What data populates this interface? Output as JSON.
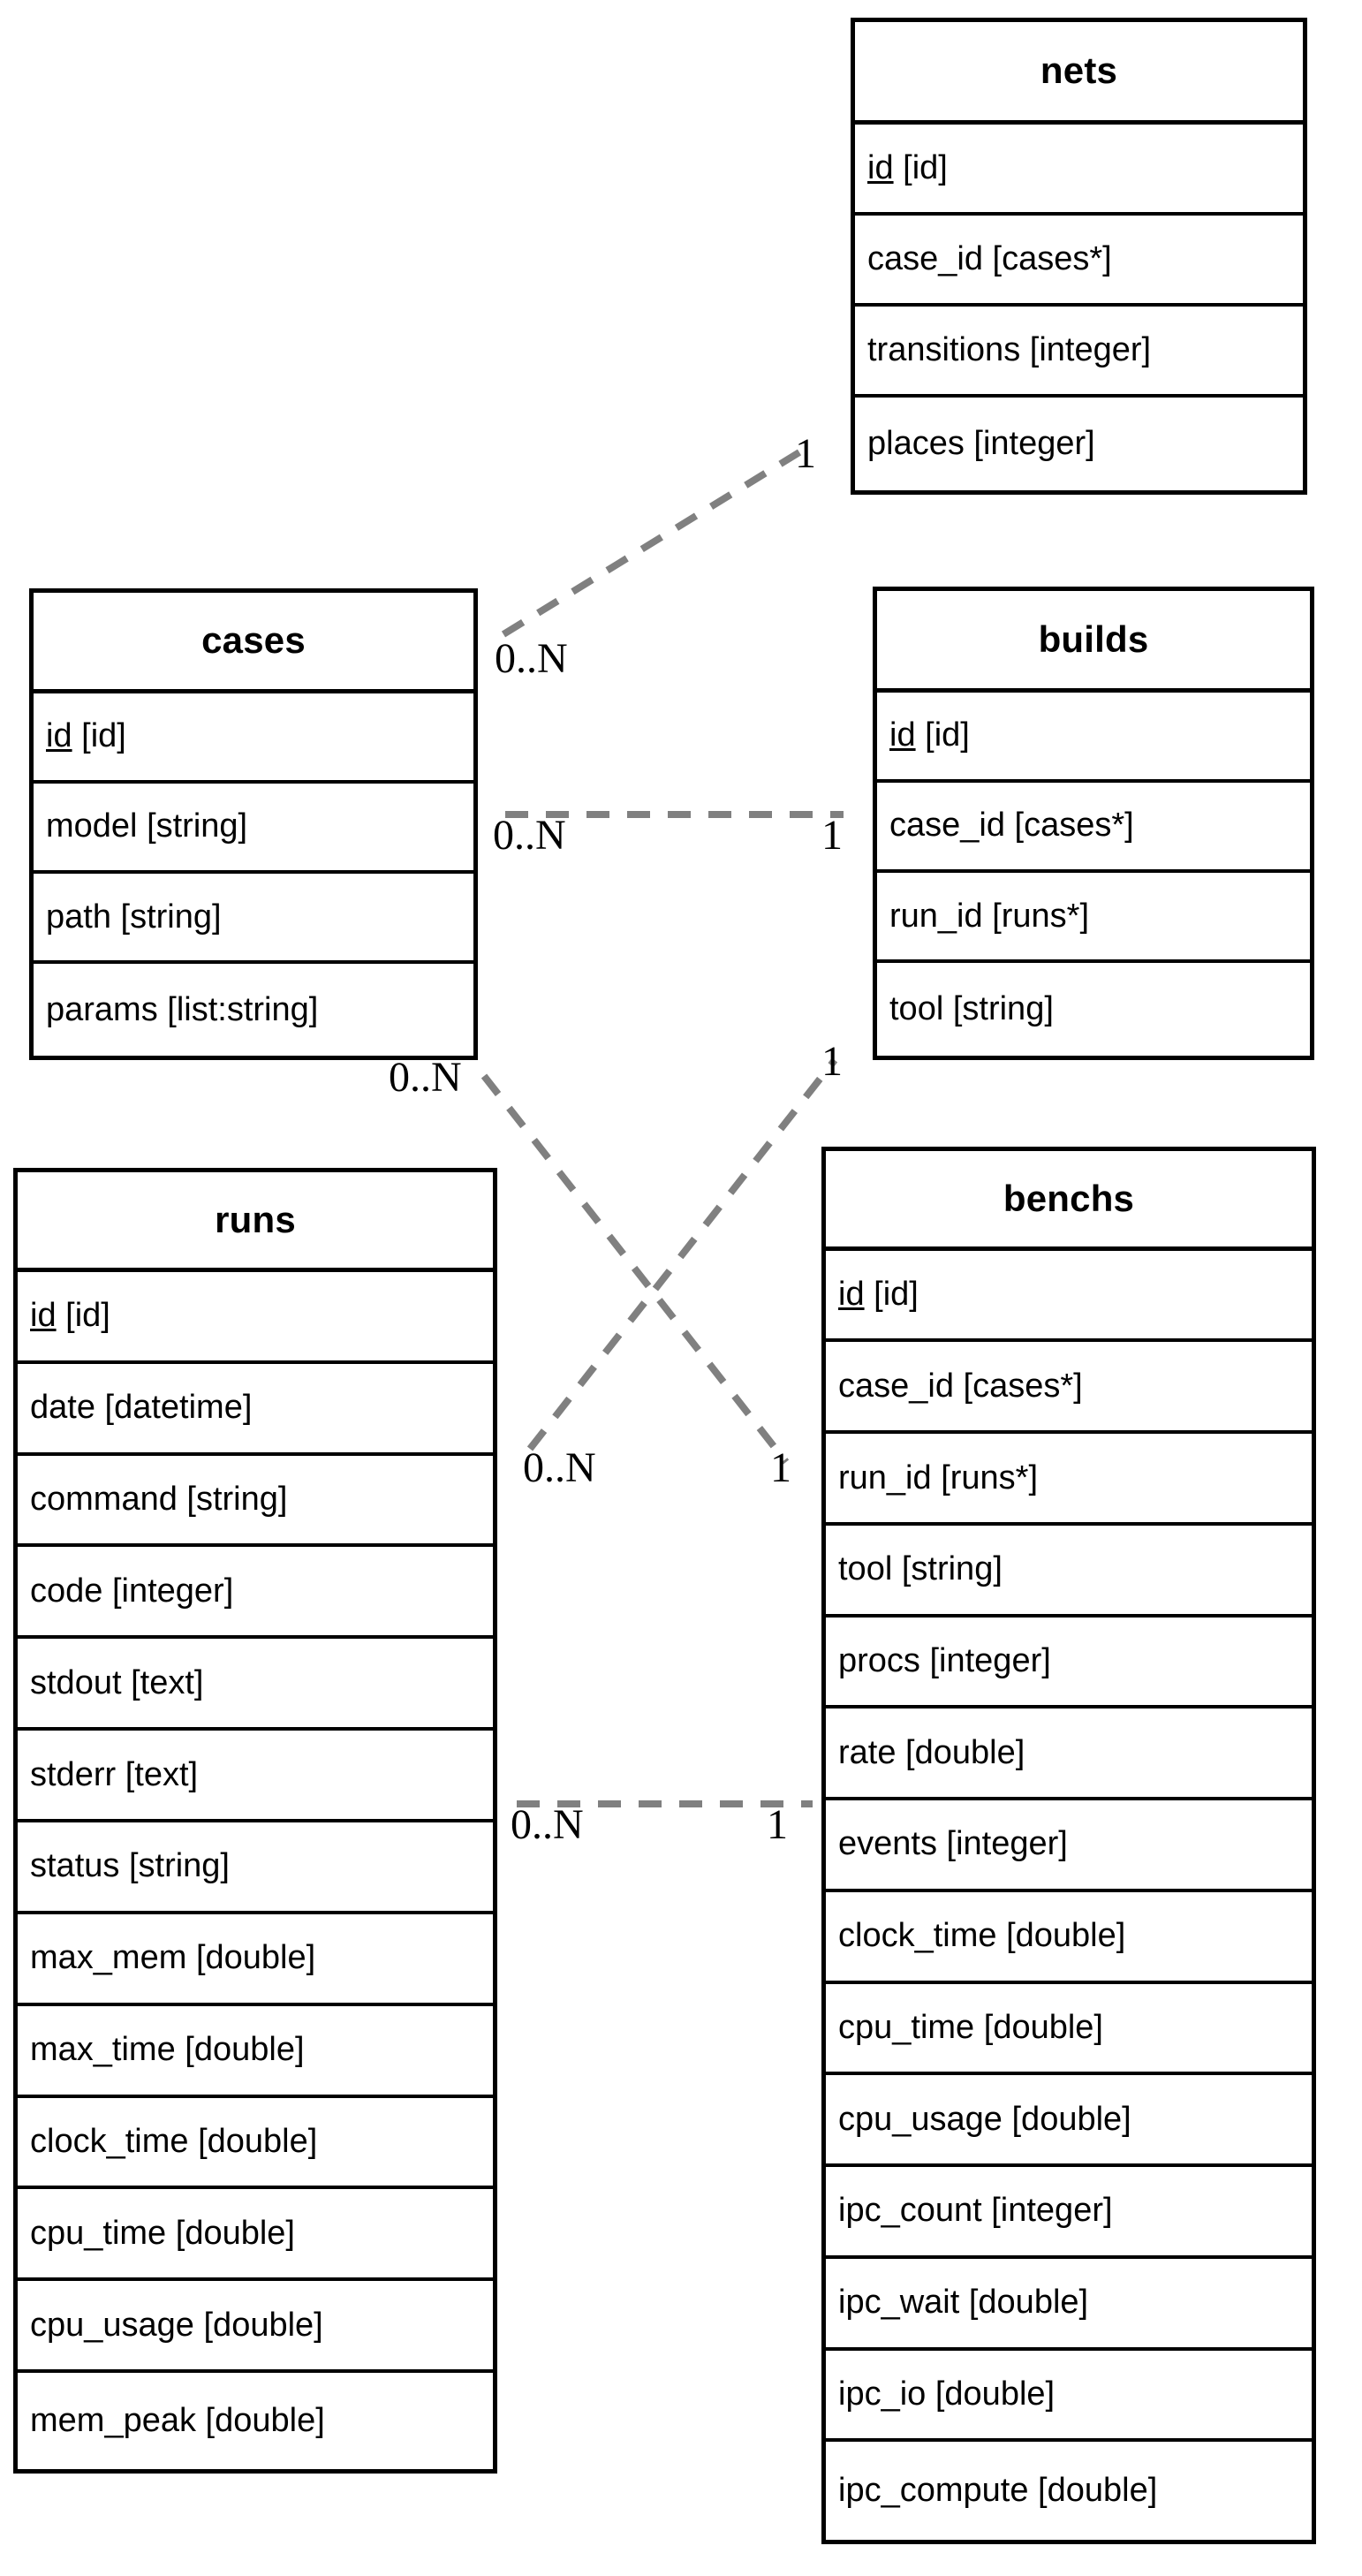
{
  "diagram": {
    "kind": "entity-relationship-diagram",
    "background_color": "#ffffff",
    "line_color": "#808080",
    "border_color": "#000000"
  },
  "entities": [
    {
      "id": "nets",
      "title": "nets",
      "attributes": [
        {
          "name": "id",
          "type": "[id]",
          "primary_key": true
        },
        {
          "name": "case_id",
          "type": "[cases*]",
          "primary_key": false
        },
        {
          "name": "transitions",
          "type": "[integer]",
          "primary_key": false
        },
        {
          "name": "places",
          "type": "[integer]",
          "primary_key": false
        }
      ]
    },
    {
      "id": "cases",
      "title": "cases",
      "attributes": [
        {
          "name": "id",
          "type": "[id]",
          "primary_key": true
        },
        {
          "name": "model",
          "type": "[string]",
          "primary_key": false
        },
        {
          "name": "path",
          "type": "[string]",
          "primary_key": false
        },
        {
          "name": "params",
          "type": "[list:string]",
          "primary_key": false
        }
      ]
    },
    {
      "id": "builds",
      "title": "builds",
      "attributes": [
        {
          "name": "id",
          "type": "[id]",
          "primary_key": true
        },
        {
          "name": "case_id",
          "type": "[cases*]",
          "primary_key": false
        },
        {
          "name": "run_id",
          "type": "[runs*]",
          "primary_key": false
        },
        {
          "name": "tool",
          "type": "[string]",
          "primary_key": false
        }
      ]
    },
    {
      "id": "runs",
      "title": "runs",
      "attributes": [
        {
          "name": "id",
          "type": "[id]",
          "primary_key": true
        },
        {
          "name": "date",
          "type": "[datetime]",
          "primary_key": false
        },
        {
          "name": "command",
          "type": "[string]",
          "primary_key": false
        },
        {
          "name": "code",
          "type": "[integer]",
          "primary_key": false
        },
        {
          "name": "stdout",
          "type": "[text]",
          "primary_key": false
        },
        {
          "name": "stderr",
          "type": "[text]",
          "primary_key": false
        },
        {
          "name": "status",
          "type": "[string]",
          "primary_key": false
        },
        {
          "name": "max_mem",
          "type": "[double]",
          "primary_key": false
        },
        {
          "name": "max_time",
          "type": "[double]",
          "primary_key": false
        },
        {
          "name": "clock_time",
          "type": "[double]",
          "primary_key": false
        },
        {
          "name": "cpu_time",
          "type": "[double]",
          "primary_key": false
        },
        {
          "name": "cpu_usage",
          "type": "[double]",
          "primary_key": false
        },
        {
          "name": "mem_peak",
          "type": "[double]",
          "primary_key": false
        }
      ]
    },
    {
      "id": "benchs",
      "title": "benchs",
      "attributes": [
        {
          "name": "id",
          "type": "[id]",
          "primary_key": true
        },
        {
          "name": "case_id",
          "type": "[cases*]",
          "primary_key": false
        },
        {
          "name": "run_id",
          "type": "[runs*]",
          "primary_key": false
        },
        {
          "name": "tool",
          "type": "[string]",
          "primary_key": false
        },
        {
          "name": "procs",
          "type": "[integer]",
          "primary_key": false
        },
        {
          "name": "rate",
          "type": "[double]",
          "primary_key": false
        },
        {
          "name": "events",
          "type": "[integer]",
          "primary_key": false
        },
        {
          "name": "clock_time",
          "type": "[double]",
          "primary_key": false
        },
        {
          "name": "cpu_time",
          "type": "[double]",
          "primary_key": false
        },
        {
          "name": "cpu_usage",
          "type": "[double]",
          "primary_key": false
        },
        {
          "name": "ipc_count",
          "type": "[integer]",
          "primary_key": false
        },
        {
          "name": "ipc_wait",
          "type": "[double]",
          "primary_key": false
        },
        {
          "name": "ipc_io",
          "type": "[double]",
          "primary_key": false
        },
        {
          "name": "ipc_compute",
          "type": "[double]",
          "primary_key": false
        }
      ]
    }
  ],
  "relationships": [
    {
      "id": "cases-nets",
      "from_entity": "cases",
      "to_entity": "nets",
      "from_cardinality": "0..N",
      "to_cardinality": "1"
    },
    {
      "id": "cases-builds",
      "from_entity": "cases",
      "to_entity": "builds",
      "from_cardinality": "0..N",
      "to_cardinality": "1"
    },
    {
      "id": "cases-benchs",
      "from_entity": "cases",
      "to_entity": "benchs",
      "from_cardinality": "0..N",
      "to_cardinality": "1"
    },
    {
      "id": "runs-builds",
      "from_entity": "runs",
      "to_entity": "builds",
      "from_cardinality": "0..N",
      "to_cardinality": "1"
    },
    {
      "id": "runs-benchs",
      "from_entity": "runs",
      "to_entity": "benchs",
      "from_cardinality": "0..N",
      "to_cardinality": "1"
    }
  ]
}
